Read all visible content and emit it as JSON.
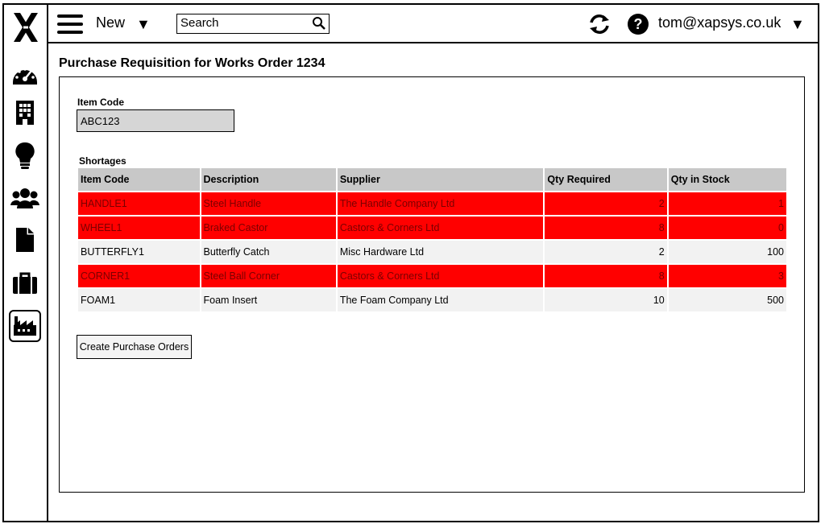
{
  "header": {
    "new_label": "New",
    "search_placeholder": "Search",
    "user_email": "tom@xapsys.co.uk"
  },
  "sidebar": {
    "items": [
      {
        "icon": "dashboard-icon"
      },
      {
        "icon": "building-icon"
      },
      {
        "icon": "lightbulb-icon"
      },
      {
        "icon": "users-icon"
      },
      {
        "icon": "document-icon"
      },
      {
        "icon": "briefcase-icon"
      },
      {
        "icon": "factory-icon",
        "active": true
      }
    ]
  },
  "main": {
    "title": "Purchase Requisition for Works Order 1234",
    "item_code_label": "Item Code",
    "item_code_value": "ABC123",
    "shortages_label": "Shortages",
    "columns": [
      "Item Code",
      "Description",
      "Supplier",
      "Qty Required",
      "Qty in Stock"
    ],
    "rows": [
      {
        "code": "HANDLE1",
        "description": "Steel Handle",
        "supplier": "The Handle Company Ltd",
        "qty_required": "2",
        "qty_stock": "1",
        "shortage": true
      },
      {
        "code": "WHEEL1",
        "description": "Braked Castor",
        "supplier": "Castors & Corners Ltd",
        "qty_required": "8",
        "qty_stock": "0",
        "shortage": true
      },
      {
        "code": "BUTTERFLY1",
        "description": "Butterfly Catch",
        "supplier": "Misc Hardware Ltd",
        "qty_required": "2",
        "qty_stock": "100",
        "shortage": false
      },
      {
        "code": "CORNER1",
        "description": "Steel Ball Corner",
        "supplier": "Castors & Corners Ltd",
        "qty_required": "8",
        "qty_stock": "3",
        "shortage": true
      },
      {
        "code": "FOAM1",
        "description": "Foam Insert",
        "supplier": "The Foam Company Ltd",
        "qty_required": "10",
        "qty_stock": "500",
        "shortage": false
      }
    ],
    "create_button": "Create Purchase Orders"
  },
  "colors": {
    "shortage_row": "#ff0000",
    "header_bg": "#c8c8c8",
    "row_bg": "#f2f2f2"
  }
}
